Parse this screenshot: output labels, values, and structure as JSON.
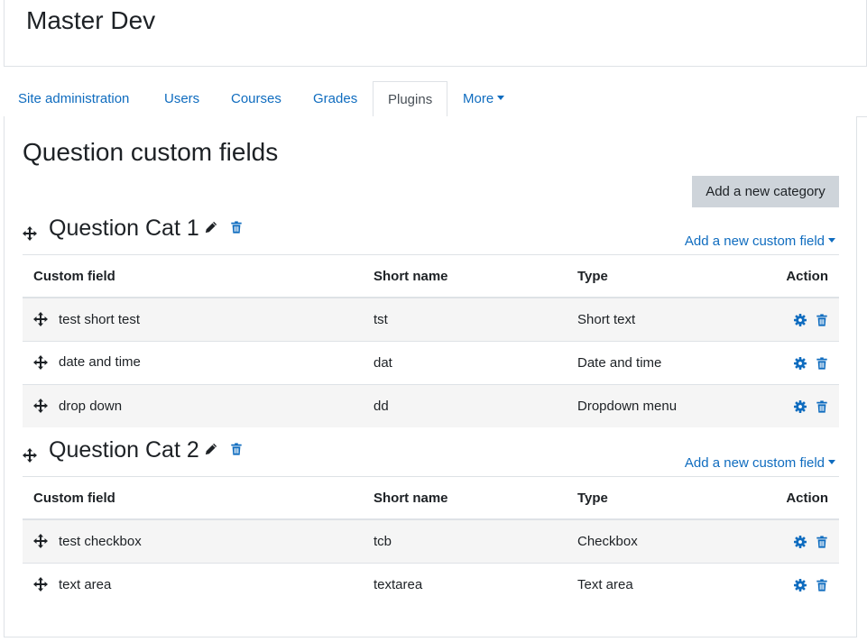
{
  "site": {
    "title": "Master Dev"
  },
  "nav": {
    "tabs": [
      {
        "label": "Site administration"
      },
      {
        "label": "Users"
      },
      {
        "label": "Courses"
      },
      {
        "label": "Grades"
      },
      {
        "label": "Plugins"
      },
      {
        "label": "More"
      }
    ],
    "active": "Plugins"
  },
  "page": {
    "title": "Question custom fields",
    "add_category_label": "Add a new category"
  },
  "table_headers": {
    "field": "Custom field",
    "short_name": "Short name",
    "type": "Type",
    "action": "Action"
  },
  "categories": [
    {
      "name": "Question Cat 1",
      "add_field_label": "Add a new custom field",
      "fields": [
        {
          "name": "test short test",
          "short_name": "tst",
          "type": "Short text"
        },
        {
          "name": "date and time",
          "short_name": "dat",
          "type": "Date and time"
        },
        {
          "name": "drop down",
          "short_name": "dd",
          "type": "Dropdown menu"
        }
      ]
    },
    {
      "name": "Question Cat 2",
      "add_field_label": "Add a new custom field",
      "fields": [
        {
          "name": "test checkbox",
          "short_name": "tcb",
          "type": "Checkbox"
        },
        {
          "name": "text area",
          "short_name": "textarea",
          "type": "Text area"
        }
      ]
    }
  ],
  "icons": {
    "move": "move-icon",
    "edit": "pencil-icon",
    "delete": "trash-icon",
    "settings": "gear-icon"
  },
  "colors": {
    "link": "#0f6cbf",
    "button_secondary": "#ced4da",
    "border": "#dee2e6",
    "row_stripe": "#f5f5f5"
  }
}
